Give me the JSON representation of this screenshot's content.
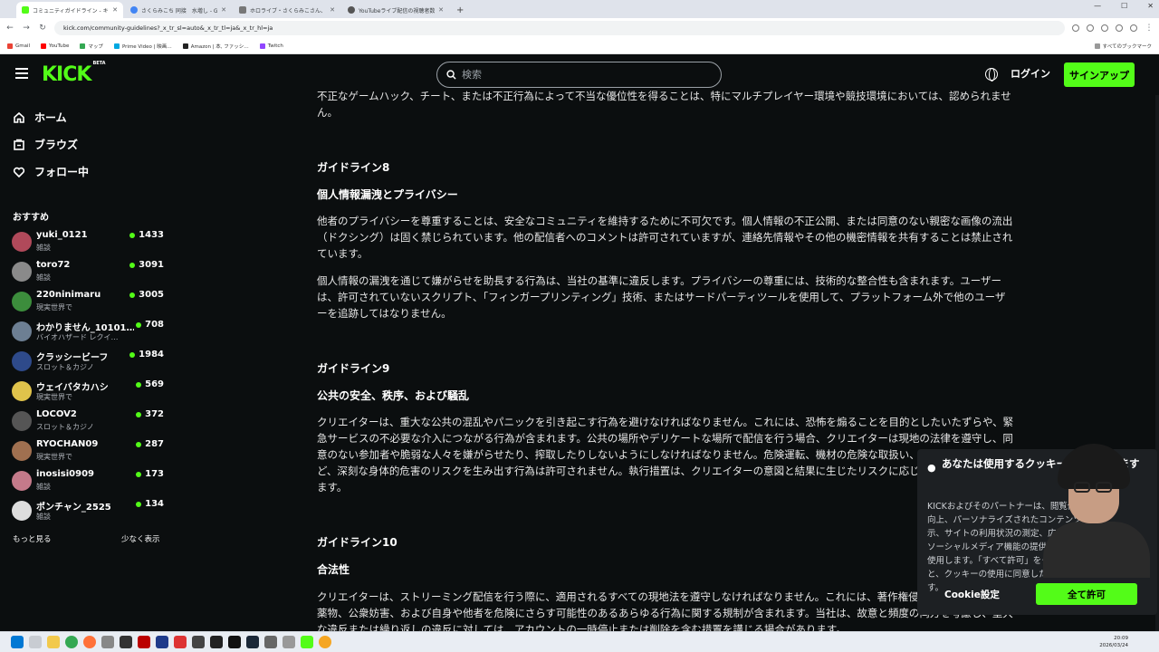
{
  "browser": {
    "tabs": [
      {
        "title": "コミュニティガイドライン - キックストリ",
        "active": true,
        "color": "#53fc18"
      },
      {
        "title": "さくらみこち 同接　水増し - Google",
        "active": false,
        "color": "#4285f4"
      },
      {
        "title": "ホロライブ・さくらみこさん、配信の疑",
        "active": false,
        "color": "#777777"
      },
      {
        "title": "YouTubeライブ配信の視聴者数や",
        "active": false,
        "color": "#555555"
      }
    ],
    "new_tab": "+",
    "url": "kick.com/community-guidelines?_x_tr_sl=auto&_x_tr_tl=ja&_x_tr_hl=ja",
    "bookmarks": [
      {
        "label": "Gmail",
        "color": "#ea4335"
      },
      {
        "label": "YouTube",
        "color": "#ff0000"
      },
      {
        "label": "マップ",
        "color": "#34a853"
      },
      {
        "label": "Prime Video | 映画…",
        "color": "#00a8e1"
      },
      {
        "label": "Amazon | 本, ファッシ…",
        "color": "#222222"
      },
      {
        "label": "Twitch",
        "color": "#9146ff"
      }
    ],
    "bookmarks_right": "すべてのブックマーク"
  },
  "nav": {
    "logo": "KICK",
    "logo_badge": "BETA",
    "search_placeholder": "検索",
    "login": "ログイン",
    "signup": "サインアップ"
  },
  "sidebar": {
    "items": [
      {
        "label": "ホーム",
        "icon": "home-icon"
      },
      {
        "label": "ブラウズ",
        "icon": "browse-icon"
      },
      {
        "label": "フォロー中",
        "icon": "heart-icon"
      }
    ],
    "section_title": "おすすめ",
    "channels": [
      {
        "name": "yuki_0121",
        "category": "雑談",
        "viewers": "1433",
        "color": "#b0495a"
      },
      {
        "name": "toro72",
        "category": "雑談",
        "viewers": "3091",
        "color": "#8a8a8a"
      },
      {
        "name": "220ninimaru",
        "category": "現実世界で",
        "viewers": "3005",
        "color": "#3c8d3c"
      },
      {
        "name": "わかりません_10101…",
        "category": "バイオハザード レクイ…",
        "viewers": "708",
        "color": "#6d7f93"
      },
      {
        "name": "クラッシービーフ",
        "category": "スロット＆カジノ",
        "viewers": "1984",
        "color": "#2e4a8a"
      },
      {
        "name": "ウェイバタカハシ",
        "category": "現実世界で",
        "viewers": "569",
        "color": "#e0c34b"
      },
      {
        "name": "LOCOV2",
        "category": "スロット＆カジノ",
        "viewers": "372",
        "color": "#555555"
      },
      {
        "name": "RYOCHAN09",
        "category": "現実世界で",
        "viewers": "287",
        "color": "#a07050"
      },
      {
        "name": "inosisi0909",
        "category": "雑談",
        "viewers": "173",
        "color": "#c47a8a"
      },
      {
        "name": "ポンチャン_2525",
        "category": "雑談",
        "viewers": "134",
        "color": "#dddddd"
      }
    ],
    "show_more": "もっと見る",
    "show_less": "少なく表示"
  },
  "content": {
    "top_partial": "不正なゲームハック、チート、または不正行為によって不当な優位性を得ることは、特にマルチプレイヤー環境や競技環境においては、認められません。",
    "g8_title": "ガイドライン8",
    "g8_subtitle": "個人情報漏洩とプライバシー",
    "g8_p1": "他者のプライバシーを尊重することは、安全なコミュニティを維持するために不可欠です。個人情報の不正公開、または同意のない親密な画像の流出（ドクシング）は固く禁じられています。他の配信者へのコメントは許可されていますが、連絡先情報やその他の機密情報を共有することは禁止されています。",
    "g8_p2": "個人情報の漏洩を通じて嫌がらせを助長する行為は、当社の基準に違反します。プライバシーの尊重には、技術的な整合性も含まれます。ユーザーは、許可されていないスクリプト、「フィンガープリンティング」技術、またはサードパーティツールを使用して、プラットフォーム外で他のユーザーを追跡してはなりません。",
    "g9_title": "ガイドライン9",
    "g9_subtitle": "公共の安全、秩序、および騒乱",
    "g9_p1": "クリエイターは、重大な公共の混乱やパニックを引き起こす行為を避けなければなりません。これには、恐怖を煽ることを目的としたいたずらや、緊急サービスの不必要な介入につながる行為が含まれます。公共の場所やデリケートな場所で配信を行う場合、クリエイターは現地の法律を遵守し、同意のない参加者や脆弱な人々を嫌がらせたり、搾取したりしないようにしなければなりません。危険運転、機材の危険な取扱い、視聴者の危険化など、深刻な身体的危害のリスクを生み出す行為は許可されません。執行措置は、クリエイターの意図と結果に生じたリスクに応じて適切なものとなります。",
    "g10_title": "ガイドライン10",
    "g10_subtitle": "合法性",
    "g10_p1": "クリエイターは、ストリーミング配信を行う際に、適用されるすべての現地法を遵守しなければなりません。これには、著作権侵害、不法侵入、違法薬物、公衆妨害、および自身や他者を危険にさらす可能性のあるあらゆる行為に関する規制が含まれます。当社は、故意と頻度の両方を考慮し、重大な違反または繰り返しの違反に対しては、アカウントの一時停止または削除を含む措置を講じる場合があります。"
  },
  "cookie": {
    "title": "あなたは使用するクッキーを管理できます",
    "body": "KICKおよびそのパートナーは、閲覧体験の向上、パーソナライズされたコンテンツの表示、サイトの利用状況の測定、広告の配信、ソーシャルメディア機能の提供にクッキーを使用します。「すべて許可」をクリックすると、クッキーの使用に同意したことになります。",
    "settings": "Cookie設定",
    "accept_all": "全て許可"
  },
  "taskbar": {
    "time": "20:09",
    "date": "2026/03/24"
  },
  "colors": {
    "brand": "#53fc18",
    "background": "#0b0e0f"
  }
}
